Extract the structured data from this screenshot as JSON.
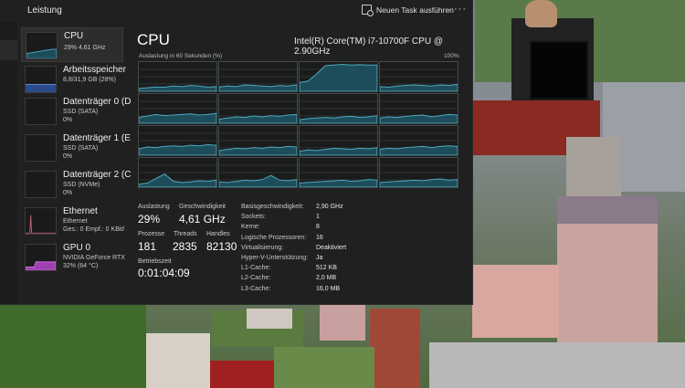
{
  "window": {
    "title": "Leistung",
    "new_task_label": "Neuen Task ausführen",
    "more_label": "···"
  },
  "sidebar": {
    "items": [
      {
        "name": "CPU",
        "sub1": "29%  4,61 GHz",
        "sub2": ""
      },
      {
        "name": "Arbeitsspeicher",
        "sub1": "8,8/31,9 GB (28%)",
        "sub2": ""
      },
      {
        "name": "Datenträger 0 (D",
        "sub1": "SSD (SATA)",
        "sub2": "0%"
      },
      {
        "name": "Datenträger 1 (E",
        "sub1": "SSD (SATA)",
        "sub2": "0%"
      },
      {
        "name": "Datenträger 2 (C",
        "sub1": "SSD (NVMe)",
        "sub2": "0%"
      },
      {
        "name": "Ethernet",
        "sub1": "Ethernet",
        "sub2": "Ges.: 0  Empf.: 0 KBit/"
      },
      {
        "name": "GPU 0",
        "sub1": "NVIDIA GeForce RTX",
        "sub2": "32% (64 °C)"
      }
    ]
  },
  "main": {
    "title": "CPU",
    "model": "Intel(R) Core(TM) i7-10700F CPU @ 2.90GHz",
    "axis_left": "Auslastung in 60 Sekunden (%)",
    "axis_right": "100%",
    "core_loads": [
      [
        10,
        12,
        15,
        14,
        18,
        16,
        20,
        18,
        14,
        16
      ],
      [
        15,
        18,
        16,
        22,
        20,
        18,
        16,
        20,
        18,
        22
      ],
      [
        30,
        35,
        60,
        88,
        90,
        92,
        90,
        91,
        90,
        90
      ],
      [
        16,
        14,
        18,
        20,
        22,
        20,
        18,
        22,
        20,
        24
      ],
      [
        20,
        25,
        30,
        26,
        28,
        30,
        32,
        28,
        30,
        34
      ],
      [
        14,
        18,
        22,
        20,
        25,
        22,
        26,
        24,
        28,
        30
      ],
      [
        12,
        16,
        18,
        20,
        18,
        22,
        24,
        20,
        22,
        26
      ],
      [
        18,
        22,
        20,
        24,
        26,
        28,
        22,
        26,
        30,
        28
      ],
      [
        22,
        28,
        26,
        30,
        32,
        30,
        34,
        32,
        36,
        34
      ],
      [
        16,
        20,
        24,
        22,
        26,
        24,
        28,
        26,
        30,
        28
      ],
      [
        14,
        18,
        16,
        20,
        24,
        22,
        20,
        24,
        22,
        26
      ],
      [
        20,
        24,
        22,
        26,
        28,
        30,
        26,
        30,
        32,
        30
      ],
      [
        10,
        14,
        30,
        45,
        20,
        16,
        18,
        22,
        20,
        24
      ],
      [
        18,
        16,
        20,
        24,
        22,
        26,
        40,
        24,
        22,
        26
      ],
      [
        14,
        16,
        18,
        20,
        22,
        24,
        20,
        22,
        26,
        24
      ],
      [
        16,
        18,
        20,
        22,
        24,
        22,
        26,
        28,
        24,
        26
      ]
    ],
    "stats": {
      "auslastung_label": "Auslastung",
      "auslastung": "29%",
      "geschw_label": "Geschwindigkeit",
      "geschw": "4,61 GHz",
      "prozesse_label": "Prozesse",
      "prozesse": "181",
      "threads_label": "Threads",
      "threads": "2835",
      "handles_label": "Handles",
      "handles": "82130",
      "betrieb_label": "Betriebszeit",
      "betrieb": "0:01:04:09"
    },
    "specs": [
      {
        "k": "Basisgeschwindigkeit:",
        "v": "2,90 GHz"
      },
      {
        "k": "Sockets:",
        "v": "1"
      },
      {
        "k": "Kerne:",
        "v": "8"
      },
      {
        "k": "Logische Prozessoren:",
        "v": "16"
      },
      {
        "k": "Virtualisierung:",
        "v": "Deaktiviert"
      },
      {
        "k": "Hyper-V-Unterstützung:",
        "v": "Ja"
      },
      {
        "k": "L1-Cache:",
        "v": "512 KB"
      },
      {
        "k": "L2-Cache:",
        "v": "2,0 MB"
      },
      {
        "k": "L3-Cache:",
        "v": "16,0 MB"
      }
    ]
  },
  "colors": {
    "cpu_line": "#4fa8c0",
    "cpu_fill": "#1d4d5a",
    "gpu_fill": "#a040b0"
  }
}
